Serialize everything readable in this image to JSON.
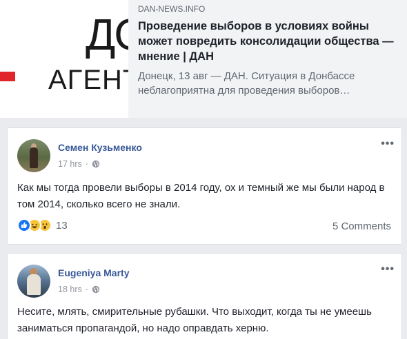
{
  "link_preview": {
    "thumbnail_letters": "ДО",
    "thumbnail_text": "АГЕНТ",
    "domain": "DAN-NEWS.INFO",
    "headline": "Проведение выборов в условиях войны может повредить консолидации общества — мнение | ДАН",
    "description": "Донецк, 13 авг — ДАН. Ситуация в Донбассе неблагоприятна для проведения выборов…"
  },
  "comments": [
    {
      "author": "Семен Кузьменко",
      "time": "17 hrs",
      "separator": "·",
      "text": "Как мы тогда провели выборы в 2014 году, ох и темный же мы были народ в том 2014, сколько всего не знали.",
      "reaction_count": "13",
      "reactions": [
        "like-icon",
        "haha-icon",
        "wow-icon"
      ],
      "comments_label": "5 Comments"
    },
    {
      "author": "Eugeniya Marty",
      "time": "18 hrs",
      "separator": "·",
      "text": "Несите, млять, смирительные рубашки. Что выходит, когда ты не умеешь заниматься пропагандой, но надо оправдать херню."
    }
  ],
  "colors": {
    "author_link": "#385898",
    "secondary_text": "#606770",
    "like_blue": "#1877f2",
    "emoji_yellow": "#f7c53a"
  }
}
